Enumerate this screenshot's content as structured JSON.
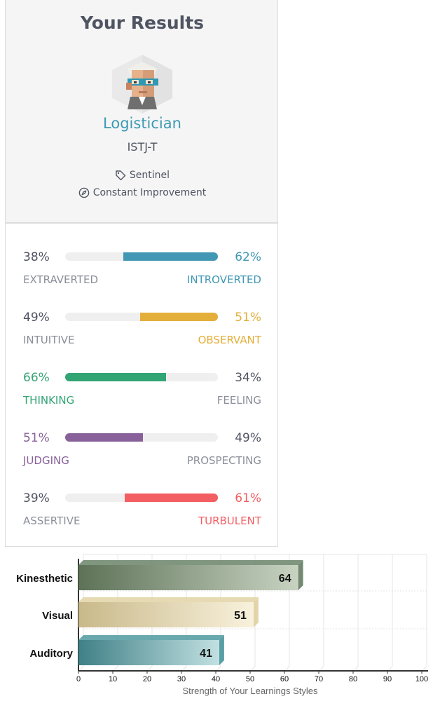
{
  "header": {
    "title": "Your Results",
    "type_name": "Logistician",
    "type_code": "ISTJ-T",
    "role": "Sentinel",
    "strategy": "Constant Improvement",
    "avatar_icon": "logistician-avatar-icon",
    "role_icon": "tag-icon",
    "strategy_icon": "compass-icon"
  },
  "traits": [
    {
      "left_pct": "38%",
      "right_pct": "62%",
      "left_label": "EXTRAVERTED",
      "right_label": "INTROVERTED",
      "dominant": "right",
      "fill_fraction": 0.62,
      "color": "#4298b4"
    },
    {
      "left_pct": "49%",
      "right_pct": "51%",
      "left_label": "INTUITIVE",
      "right_label": "OBSERVANT",
      "dominant": "right",
      "fill_fraction": 0.51,
      "color": "#e4ae3a"
    },
    {
      "left_pct": "66%",
      "right_pct": "34%",
      "left_label": "THINKING",
      "right_label": "FEELING",
      "dominant": "left",
      "fill_fraction": 0.66,
      "color": "#33a474"
    },
    {
      "left_pct": "51%",
      "right_pct": "49%",
      "left_label": "JUDGING",
      "right_label": "PROSPECTING",
      "dominant": "left",
      "fill_fraction": 0.51,
      "color": "#88619a"
    },
    {
      "left_pct": "39%",
      "right_pct": "61%",
      "left_label": "ASSERTIVE",
      "right_label": "TURBULENT",
      "dominant": "right",
      "fill_fraction": 0.61,
      "color": "#f25e62"
    }
  ],
  "chart_data": {
    "type": "bar",
    "orientation": "horizontal",
    "categories": [
      "Kinesthetic",
      "Visual",
      "Auditory"
    ],
    "values": [
      64,
      51,
      41
    ],
    "colors": [
      "#6b8468",
      "#e0d3a4",
      "#4f9aa0"
    ],
    "xlabel": "Strength of Your Learnings Styles",
    "xlim": [
      0,
      100
    ],
    "xticks": [
      "0",
      "10",
      "20",
      "30",
      "40",
      "50",
      "60",
      "70",
      "80",
      "90",
      "100"
    ],
    "grid": true
  }
}
